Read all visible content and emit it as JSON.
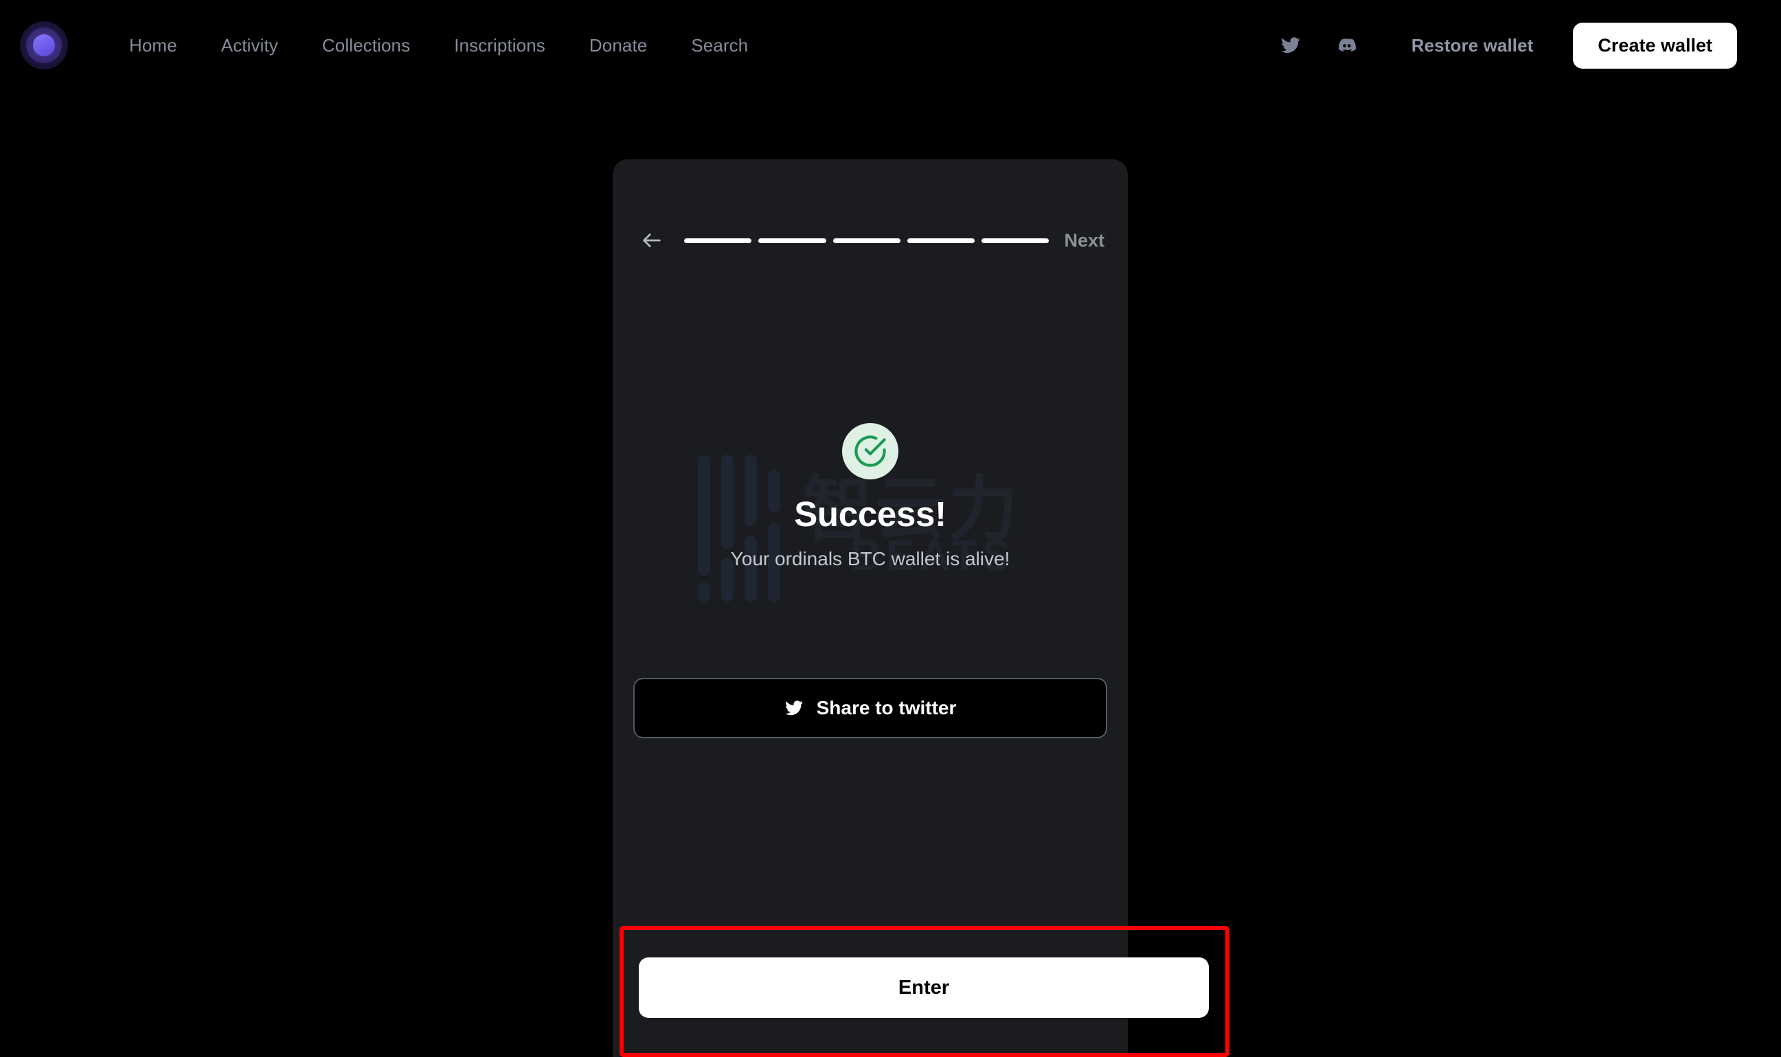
{
  "header": {
    "logo_name": "ordinals-logo",
    "nav": [
      {
        "label": "Home",
        "name": "nav-home"
      },
      {
        "label": "Activity",
        "name": "nav-activity"
      },
      {
        "label": "Collections",
        "name": "nav-collections"
      },
      {
        "label": "Inscriptions",
        "name": "nav-inscriptions"
      },
      {
        "label": "Donate",
        "name": "nav-donate"
      },
      {
        "label": "Search",
        "name": "nav-search"
      }
    ],
    "social": [
      {
        "icon": "twitter-icon"
      },
      {
        "icon": "discord-icon"
      }
    ],
    "restore_label": "Restore wallet",
    "create_label": "Create wallet"
  },
  "modal": {
    "back_icon": "arrow-left-icon",
    "next_label": "Next",
    "steps": {
      "total": 5,
      "completed": 5
    },
    "success": {
      "icon": "check-circle-icon",
      "title": "Success!",
      "subtitle": "Your ordinals BTC wallet is alive!"
    },
    "share": {
      "icon": "twitter-icon",
      "label": "Share to twitter"
    },
    "enter_label": "Enter"
  },
  "watermark": {
    "cn_text": "智云力",
    "brand_text": "BEATS"
  },
  "colors": {
    "page_background": "#000000",
    "modal_background": "#1a1c20",
    "accent_purple": "#6c5ce7",
    "success_green": "#1a9a52",
    "success_badge_bg": "#dff0e4",
    "nav_text": "#868c9c",
    "subtitle_text": "#c3c7d3",
    "highlight_red": "#ff0000",
    "button_white": "#ffffff"
  }
}
